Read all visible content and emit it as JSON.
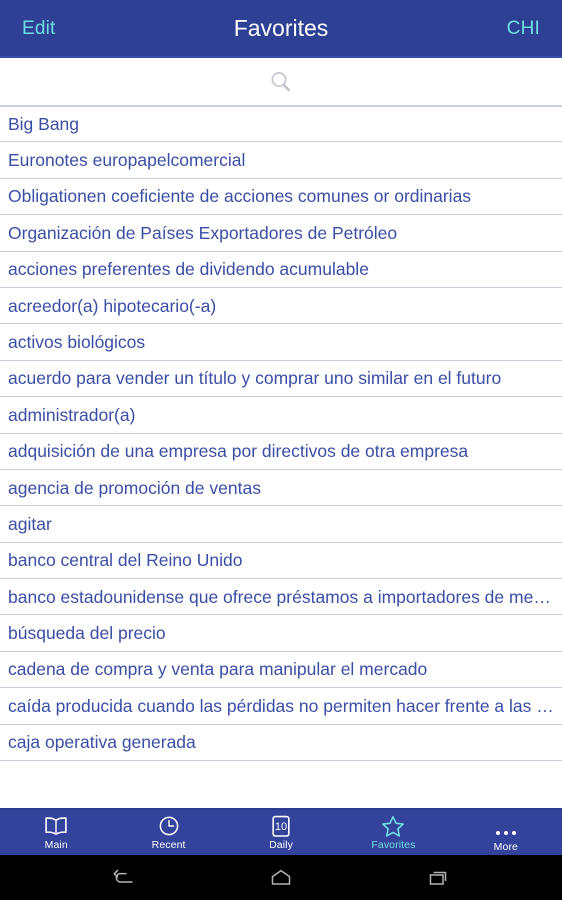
{
  "titlebar": {
    "edit_label": "Edit",
    "title": "Favorites",
    "lang_label": "CHI",
    "bg_color": "#2e4094",
    "accent_color": "#6fdde6"
  },
  "search": {
    "icon": "search-icon",
    "value": "",
    "placeholder": ""
  },
  "list": {
    "text_color": "#3b4ea6",
    "items": [
      {
        "label": "Big Bang"
      },
      {
        "label": "Euronotes europapelcomercial"
      },
      {
        "label": "Obligationen coeficiente de acciones comunes or ordinarias"
      },
      {
        "label": "Organización de Países Exportadores de Petróleo"
      },
      {
        "label": "acciones preferentes de dividendo acumulable"
      },
      {
        "label": "acreedor(a) hipotecario(-a)"
      },
      {
        "label": "activos biológicos"
      },
      {
        "label": "acuerdo para vender un título y comprar uno similar en el futuro"
      },
      {
        "label": "administrador(a)"
      },
      {
        "label": "adquisición de una empresa por directivos de otra empresa"
      },
      {
        "label": "agencia de promoción de ventas"
      },
      {
        "label": "agitar"
      },
      {
        "label": "banco central del Reino Unido"
      },
      {
        "label": "banco estadounidense que ofrece préstamos a importadores de mercancías"
      },
      {
        "label": "búsqueda del precio"
      },
      {
        "label": "cadena de compra y venta para manipular el mercado"
      },
      {
        "label": "caída producida cuando las pérdidas no permiten hacer frente a las obligaciones"
      },
      {
        "label": "caja operativa generada"
      }
    ]
  },
  "tabbar": {
    "bg_color": "#33429a",
    "active_color": "#6fdde6",
    "items": [
      {
        "label": "Main",
        "icon": "book-icon",
        "active": false
      },
      {
        "label": "Recent",
        "icon": "clock-icon",
        "active": false
      },
      {
        "label": "Daily",
        "icon": "calendar-icon",
        "badge": "10",
        "active": false
      },
      {
        "label": "Favorites",
        "icon": "star-icon",
        "active": true
      },
      {
        "label": "More",
        "icon": "ellipsis-icon",
        "active": false
      }
    ]
  },
  "sysnav": {
    "items": [
      {
        "name": "back",
        "icon": "back-arrow-icon"
      },
      {
        "name": "home",
        "icon": "home-icon"
      },
      {
        "name": "recents",
        "icon": "recents-icon"
      }
    ]
  }
}
